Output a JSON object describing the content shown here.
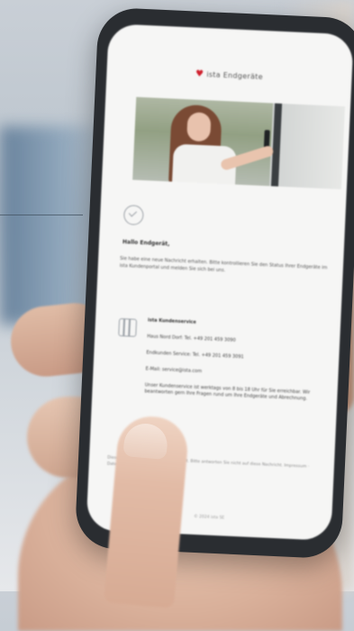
{
  "photo": {
    "brand_name": "ista Endgeräte",
    "heading": "Hallo Endgerät,",
    "paragraph": "Sie habe eine neue Nachricht erhalten. Bitte kontrollieren Sie den Status Ihrer Endgeräte im ista Kundenportal und melden Sie sich bei uns.",
    "contact_title": "ista Kundenservice",
    "contact_lines": [
      "Haus Nord Dorf: Tel. +49 201 459 3090",
      "Endkunden Service: Tel. +49 201 459 3091",
      "E-Mail: service@ista.com"
    ],
    "contact_note": "Unser Kundenservice ist werktags von 8 bis 18 Uhr für Sie erreichbar. Wir beantworten gern Ihre Fragen rund um Ihre Endgeräte und Abrechnung.",
    "footer": "Diese E-Mail wurde automatisch erstellt. Bitte antworten Sie nicht auf diese Nachricht. Impressum · Datenschutz",
    "copyright": "© 2024 ista SE"
  }
}
